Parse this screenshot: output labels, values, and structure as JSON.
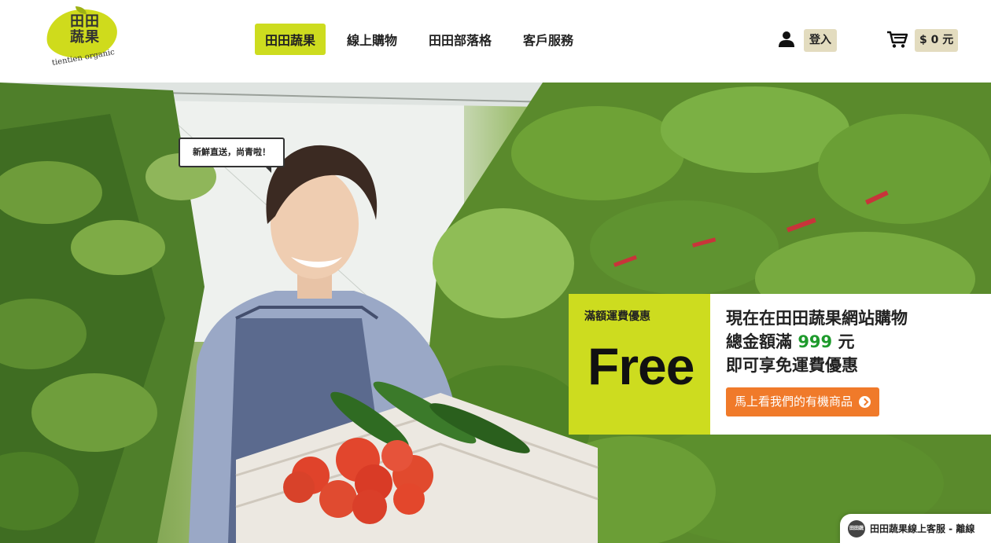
{
  "header": {
    "logo": {
      "zh": "田田\n蔬果",
      "en": "tientien organic"
    },
    "nav": [
      {
        "label": "田田蔬果",
        "active": true
      },
      {
        "label": "線上購物",
        "active": false
      },
      {
        "label": "田田部落格",
        "active": false
      },
      {
        "label": "客戶服務",
        "active": false
      }
    ],
    "login_label": "登入",
    "cart_label": "$ 0 元",
    "icons": {
      "user": "user-icon",
      "cart": "cart-icon"
    }
  },
  "hero": {
    "speech_bubble": "新鮮直送，尚青啦！",
    "promo": {
      "kicker": "滿額運費優惠",
      "headline": "Free",
      "line1": "現在在田田蔬果網站購物",
      "line2_prefix": "總金額滿 ",
      "line2_amount": "999",
      "line2_suffix": " 元",
      "line3": "即可享免運費優惠",
      "cta_label": "馬上看我們的有機商品"
    }
  },
  "chat": {
    "logo_text": "田田蔬果",
    "label": "田田蔬果線上客服 - 離線"
  },
  "colors": {
    "accent": "#cddc1f",
    "cta": "#f07a2a",
    "amount": "#1e9a2c",
    "button_bg": "#e3dcbf"
  }
}
